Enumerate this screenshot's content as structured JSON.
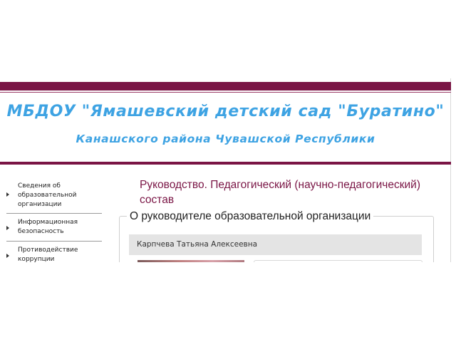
{
  "header": {
    "title": "МБДОУ \"Ямашевский детский сад \"Буратино\"",
    "subtitle": "Канашского района Чувашской Республики"
  },
  "sidebar": {
    "items": [
      {
        "label": "Сведения об образовательной организации"
      },
      {
        "label": "Информационная безопасность"
      },
      {
        "label": "Противодействие коррупции"
      }
    ]
  },
  "main": {
    "heading": "Руководство. Педагогический (научно-педагогический) состав",
    "section_legend": "О руководителе образовательной организации",
    "person_name": "Карпчева Татьяна Алексеевна"
  },
  "colors": {
    "brand": "#7a1545",
    "title": "#3ea3e3"
  }
}
